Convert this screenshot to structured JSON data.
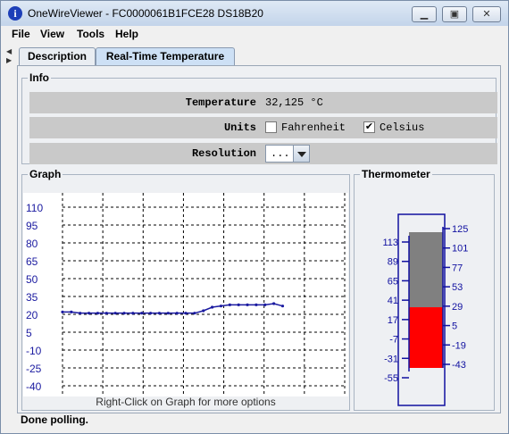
{
  "window": {
    "title": "OneWireViewer - FC0000061B1FCE28 DS18B20",
    "icon": "info-icon",
    "buttons": {
      "minimize": "▁",
      "maximize": "▣",
      "close": "✕"
    }
  },
  "menu": {
    "items": [
      "File",
      "View",
      "Tools",
      "Help"
    ]
  },
  "tabs": [
    {
      "label": "Description",
      "active": false
    },
    {
      "label": "Real-Time Temperature",
      "active": true
    }
  ],
  "info": {
    "legend": "Info",
    "temperature_label": "Temperature",
    "temperature_value": "32,125 °C",
    "units_label": "Units",
    "unit_fahrenheit": "Fahrenheit",
    "unit_fahrenheit_checked": false,
    "unit_celsius": "Celsius",
    "unit_celsius_checked": true,
    "resolution_label": "Resolution",
    "resolution_value": "..."
  },
  "graph": {
    "legend": "Graph",
    "hint": "Right-Click on Graph for more options",
    "chart_data": {
      "type": "line",
      "y_ticks": [
        "110",
        "95",
        "80",
        "65",
        "50",
        "35",
        "20",
        "5",
        "-10",
        "-25",
        "-40"
      ],
      "ylim": [
        -40,
        110
      ],
      "grid": true,
      "x": [
        0,
        2,
        4,
        6,
        8,
        10,
        12,
        14,
        16,
        18,
        20,
        22,
        24,
        26,
        28,
        30,
        32,
        34,
        36,
        38,
        40,
        42,
        44,
        46,
        48,
        50
      ],
      "values": [
        22,
        22,
        21,
        21,
        21,
        21,
        21,
        21,
        21,
        21,
        21,
        21,
        21,
        21,
        21,
        21,
        23,
        26,
        27,
        28,
        28,
        28,
        28,
        28,
        29,
        27
      ],
      "color": "#1a1aa0"
    }
  },
  "thermometer": {
    "legend": "Thermometer",
    "celsius_ticks": [
      "125",
      "101",
      "77",
      "53",
      "29",
      "5",
      "-19",
      "-43"
    ],
    "fahrenheit_ticks": [
      "113",
      "89",
      "65",
      "41",
      "17",
      "-7",
      "-31",
      "-55"
    ],
    "level_celsius": 32.125,
    "fill_color": "#ff0000",
    "empty_color": "#808080",
    "frame_color": "#1010a0"
  },
  "status": {
    "text": "Done polling."
  }
}
